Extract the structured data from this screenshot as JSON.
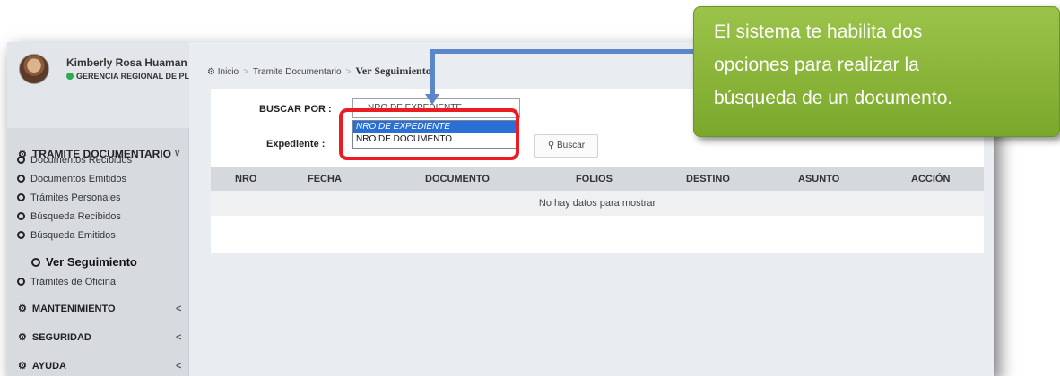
{
  "user": {
    "name": "Kimberly Rosa Huaman Fe",
    "org": "GERENCIA REGIONAL DE PLANI"
  },
  "sidebar": {
    "section_main": {
      "label": "TRAMITE DOCUMENTARIO",
      "chevron": "∨"
    },
    "items": [
      {
        "label": "Documentos Recibidos"
      },
      {
        "label": "Documentos Emitidos"
      },
      {
        "label": "Trámites Personales"
      },
      {
        "label": "Búsqueda Recibidos"
      },
      {
        "label": "Búsqueda Emitidos"
      },
      {
        "label": "Ver Seguimiento"
      },
      {
        "label": "Trámites de Oficina"
      }
    ],
    "sections": [
      {
        "label": "MANTENIMIENTO",
        "chevron": "<"
      },
      {
        "label": "SEGURIDAD",
        "chevron": "<"
      },
      {
        "label": "AYUDA",
        "chevron": "<"
      }
    ]
  },
  "breadcrumb": {
    "home": "Inicio",
    "parent": "Tramite Documentario",
    "current": "Ver Seguimiento"
  },
  "form": {
    "buscar_por_label": "BUSCAR POR :",
    "buscar_por_value": "NRO DE EXPEDIENTE",
    "options": [
      "NRO DE EXPEDIENTE",
      "NRO DE DOCUMENTO"
    ],
    "expediente_label": "Expediente :",
    "search_button": "Buscar"
  },
  "table": {
    "headers": [
      "NRO",
      "FECHA",
      "DOCUMENTO",
      "FOLIOS",
      "DESTINO",
      "ASUNTO",
      "ACCIÓN"
    ],
    "empty_message": "No hay datos para mostrar"
  },
  "annotation": {
    "lines": [
      "El sistema te habilita dos",
      "opciones para realizar la",
      "búsqueda de un documento."
    ],
    "callout_color": "#8cb83c",
    "arrow_color": "#5b86c9",
    "highlight_color": "#ec1c24"
  },
  "icons": {
    "menu": "tachometer-icon",
    "search": "search-icon",
    "bullet": "circle-icon"
  }
}
